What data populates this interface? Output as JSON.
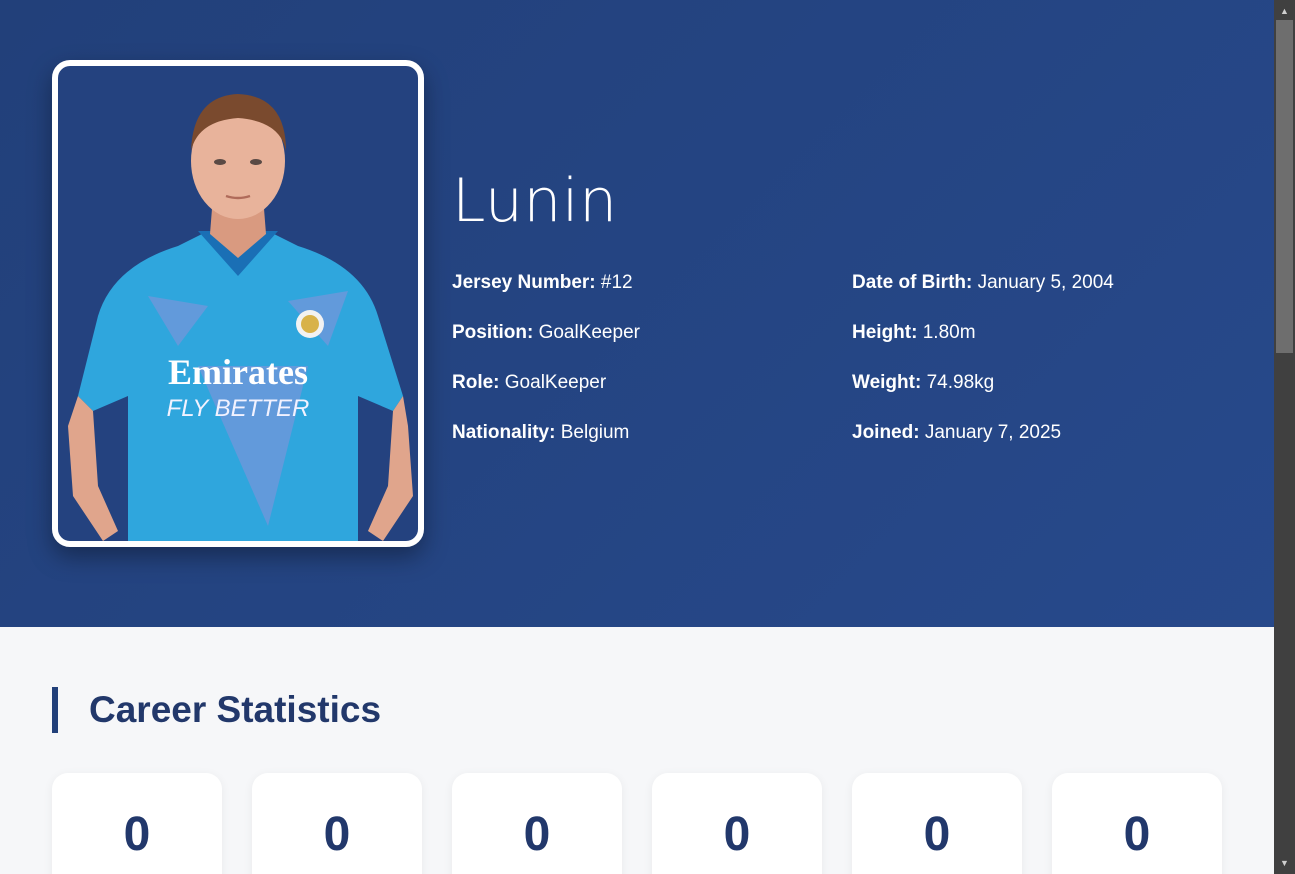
{
  "player": {
    "name": "Lunin",
    "jersey_label": "Jersey Number:",
    "jersey_value": "#12",
    "position_label": "Position:",
    "position_value": "GoalKeeper",
    "role_label": "Role:",
    "role_value": "GoalKeeper",
    "nationality_label": "Nationality:",
    "nationality_value": "Belgium",
    "dob_label": "Date of Birth:",
    "dob_value": "January 5, 2004",
    "height_label": "Height:",
    "height_value": "1.80m",
    "weight_label": "Weight:",
    "weight_value": "74.98kg",
    "joined_label": "Joined:",
    "joined_value": "January 7, 2025",
    "shirt_sponsor": "Emirates",
    "shirt_slogan": "FLY BETTER"
  },
  "stats": {
    "heading": "Career Statistics",
    "values": [
      "0",
      "0",
      "0",
      "0",
      "0",
      "0"
    ]
  },
  "colors": {
    "hero_bg": "#22407a",
    "accent": "#22386b",
    "kit": "#2fa6dd"
  }
}
